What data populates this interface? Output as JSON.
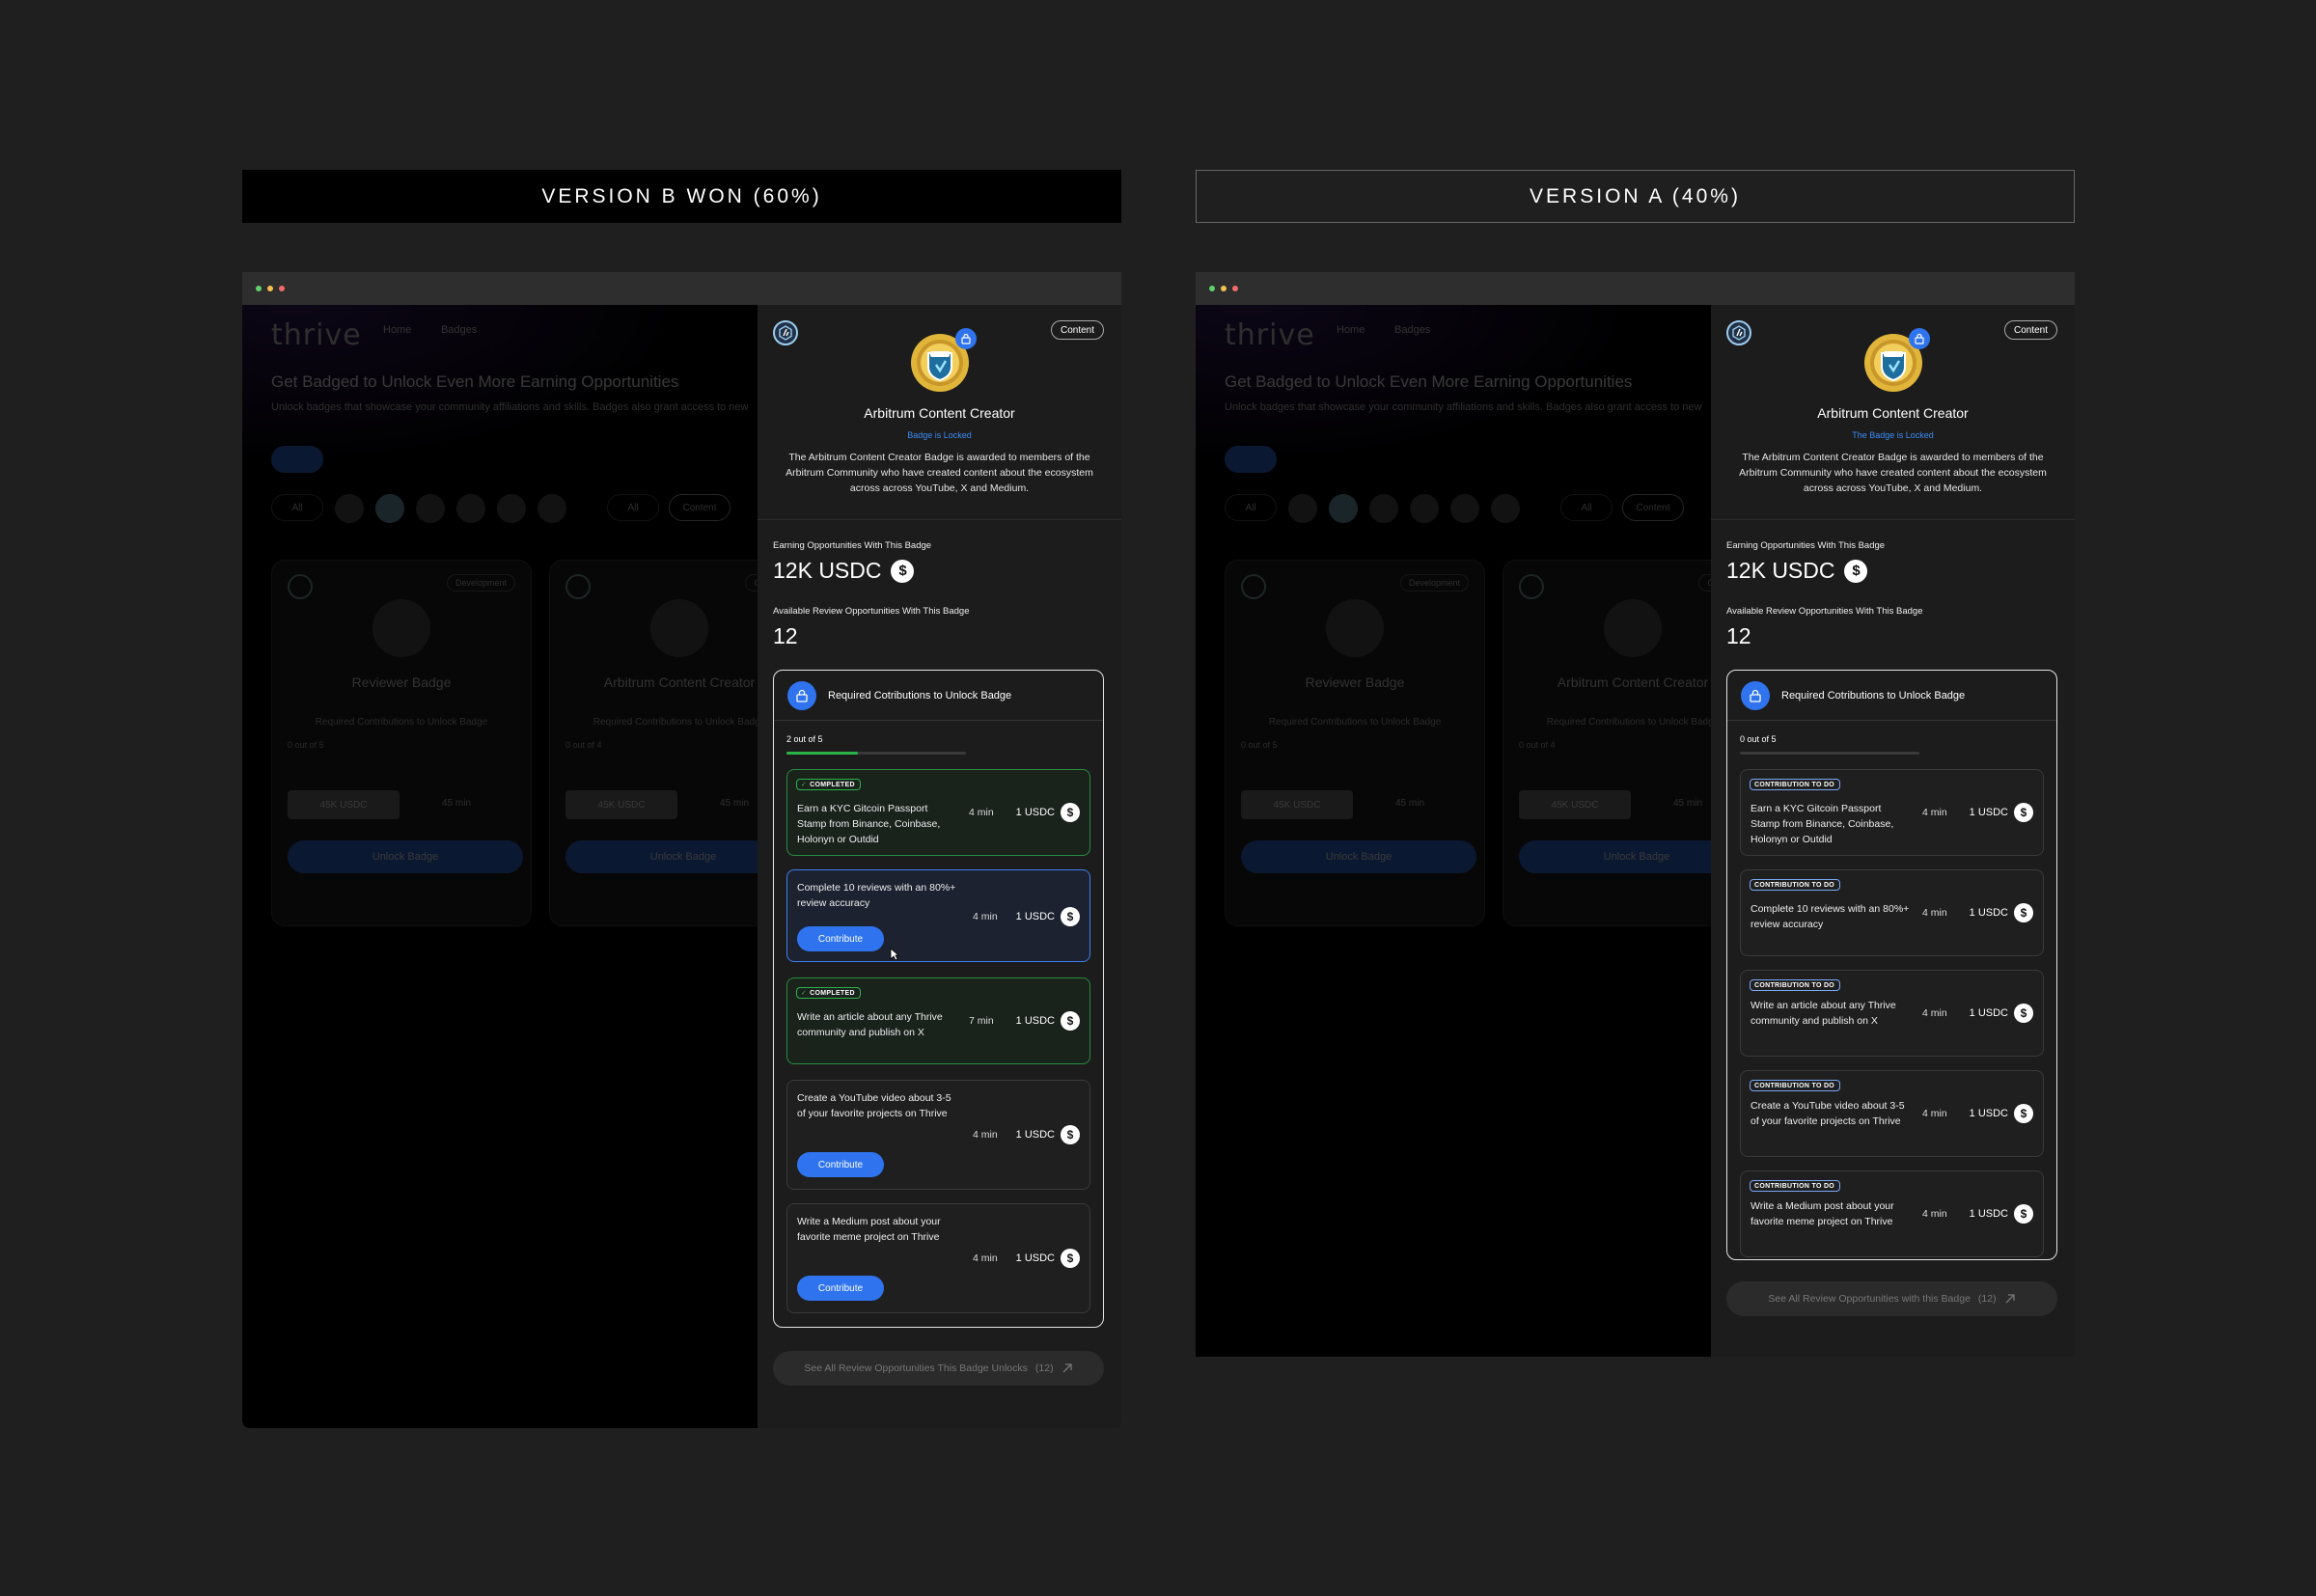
{
  "version_b": {
    "title": "VERSION B WON (60%)"
  },
  "version_a": {
    "title": "VERSION A (40%)"
  },
  "background_app": {
    "logo": "thrive",
    "nav": [
      "Home",
      "Badges"
    ],
    "heading": "Get Badged to Unlock Even More Earning Opportunities",
    "subheading": "Unlock badges that showcase your community affiliations and skills. Badges also grant access to new",
    "filter_all": "All",
    "filter_content": "Content",
    "cards": [
      {
        "tag": "Development",
        "title": "Reviewer Badge",
        "req": "Required Contributions to Unlock Badge",
        "count": "0 out of 5",
        "usdc": "45K USDC",
        "mins": "45 min",
        "button": "Unlock Badge"
      },
      {
        "tag": "Content",
        "title": "Arbitrum Content Creator",
        "req": "Required Contributions to Unlock Badge",
        "count": "0 out of 4",
        "usdc": "45K USDC",
        "mins": "45 min",
        "button": "Unlock Badge"
      }
    ]
  },
  "panel_b": {
    "tag": "Content",
    "title": "Arbitrum Content Creator",
    "status": "Badge is Locked",
    "description": "The Arbitrum Content Creator Badge is awarded to members of the Arbitrum Community who have created content about the ecosystem across across YouTube, X and Medium.",
    "earning_label": "Earning Opportunities With This Badge",
    "earning_value": "12K USDC",
    "review_label": "Available Review Opportunities With This Badge",
    "review_value": "12",
    "required_title": "Required Cotributions to Unlock Badge",
    "progress_text": "2 out of 5",
    "progress": 0.4,
    "tasks": [
      {
        "status": "COMPLETED",
        "text": "Earn a KYC Gitcoin Passport Stamp from Binance, Coinbase, Holonyn or Outdid",
        "mins": "4 min",
        "reward": "1 USDC"
      },
      {
        "status": "",
        "text": "Complete 10 reviews with an 80%+ review accuracy",
        "mins": "4 min",
        "reward": "1 USDC",
        "button": "Contribute"
      },
      {
        "status": "COMPLETED",
        "text": "Write an article about any Thrive community and publish on X",
        "mins": "7 min",
        "reward": "1 USDC"
      },
      {
        "status": "",
        "text": "Create a YouTube video about 3-5 of your favorite projects on Thrive",
        "mins": "4 min",
        "reward": "1 USDC",
        "button": "Contribute"
      },
      {
        "status": "",
        "text": "Write a Medium post about your favorite meme project on Thrive",
        "mins": "4 min",
        "reward": "1 USDC",
        "button": "Contribute"
      }
    ],
    "see_all": "See All Review Opportunities This Badge Unlocks",
    "see_all_count": "(12)"
  },
  "panel_a": {
    "tag": "Content",
    "title": "Arbitrum Content Creator",
    "status": "The Badge is Locked",
    "description": "The Arbitrum Content Creator Badge is awarded to members of the Arbitrum Community who have created content about the ecosystem across across YouTube, X and Medium.",
    "earning_label": "Earning Opportunities With This Badge",
    "earning_value": "12K USDC",
    "review_label": "Available Review Opportunities With This Badge",
    "review_value": "12",
    "required_title": "Required Cotributions to Unlock Badge",
    "progress_text": "0 out of 5",
    "progress": 0,
    "task_badge": "CONTRIBUTION TO DO",
    "tasks": [
      {
        "text": "Earn a KYC Gitcoin Passport Stamp from Binance, Coinbase, Holonyn or Outdid",
        "mins": "4 min",
        "reward": "1 USDC"
      },
      {
        "text": "Complete 10 reviews with an 80%+ review accuracy",
        "mins": "4 min",
        "reward": "1 USDC"
      },
      {
        "text": "Write an article about any Thrive community and publish on X",
        "mins": "4 min",
        "reward": "1 USDC"
      },
      {
        "text": "Create a YouTube video about 3-5 of your favorite projects on Thrive",
        "mins": "4 min",
        "reward": "1 USDC"
      },
      {
        "text": "Write a Medium post about your favorite meme project on Thrive",
        "mins": "4 min",
        "reward": "1 USDC"
      }
    ],
    "see_all": "See All Review Opportunities with this Badge",
    "see_all_count": "(12)"
  },
  "colors": {
    "accent": "#2f74ee",
    "completed": "#2bb34a",
    "locked_text": "#3b8df5"
  },
  "icons": [
    "lock-icon",
    "dollar-icon",
    "check-icon",
    "arrow-up-right-icon",
    "arbitrum-logo-icon",
    "badge-medal-icon",
    "cursor-icon"
  ]
}
